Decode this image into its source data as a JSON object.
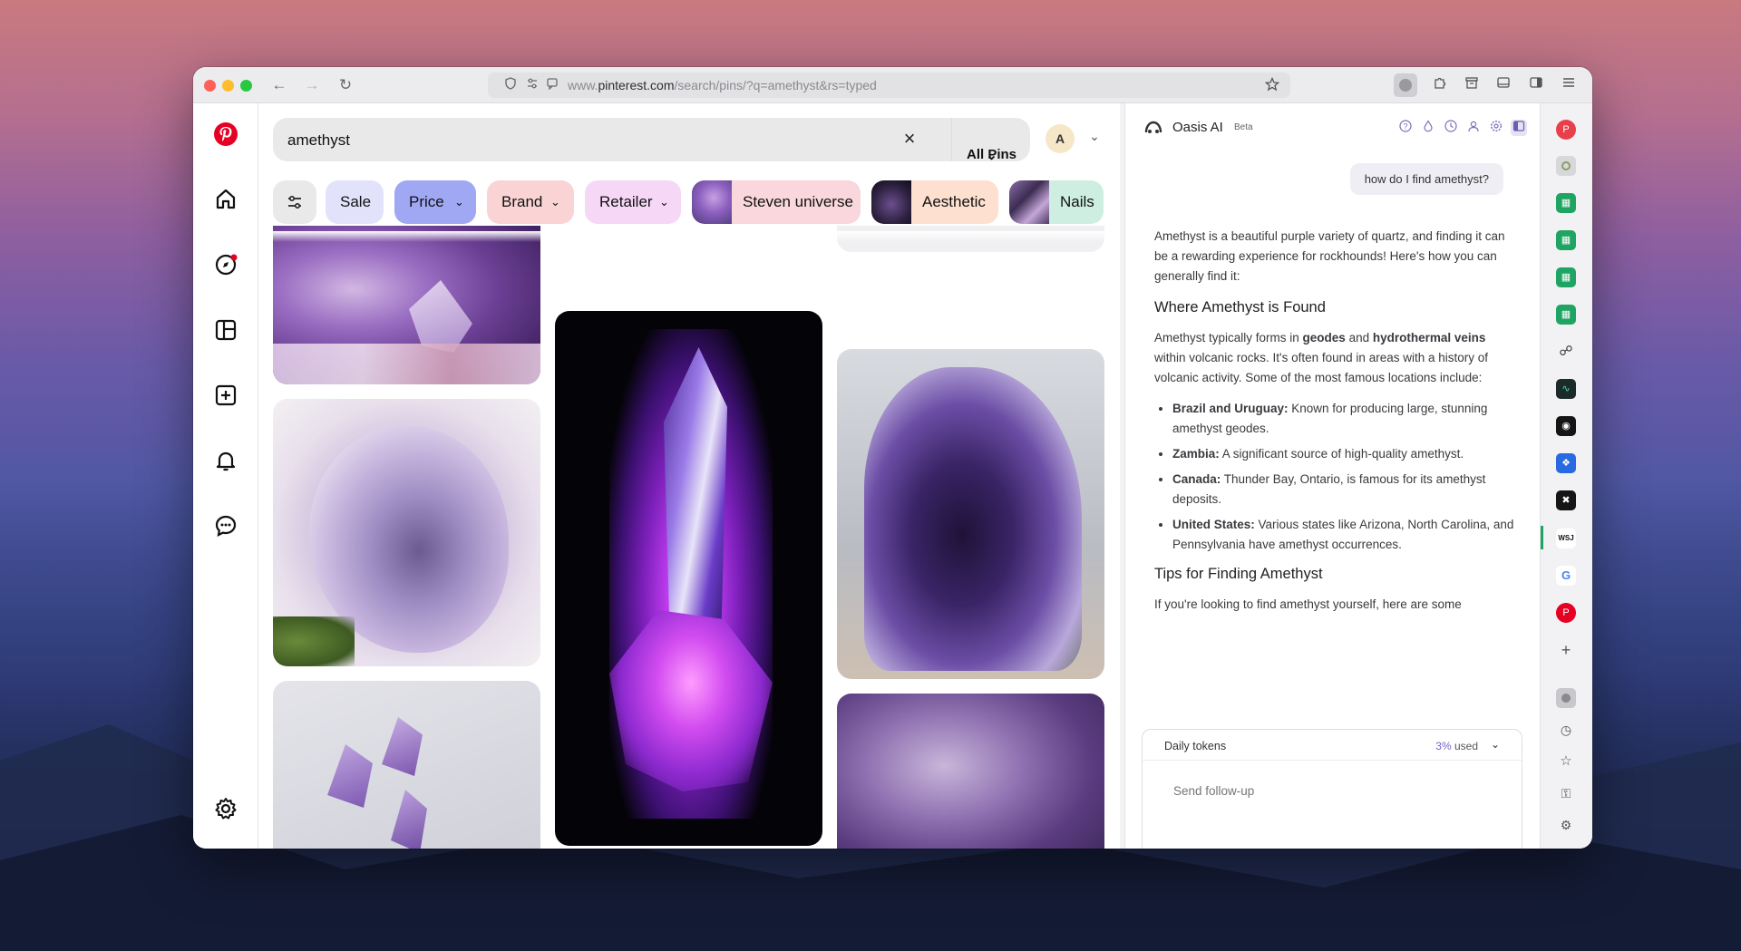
{
  "browser": {
    "url_prefix": "www.",
    "url_domain": "pinterest.com",
    "url_path": "/search/pins/?q=amethyst&rs=typed"
  },
  "search": {
    "query": "amethyst",
    "scope_label": "All Pins",
    "avatar_initial": "A"
  },
  "chips": [
    "Sale",
    "Price",
    "Brand",
    "Retailer",
    "Steven universe",
    "Aesthetic",
    "Nails"
  ],
  "colors": {
    "pinterest_red": "#e60023",
    "price_chip": "#a0a8f4",
    "brand_chip": "#fad4d4",
    "retailer_chip": "#f6d8f6",
    "accent_purple": "#6a4fa8"
  },
  "assistant": {
    "name": "Oasis AI",
    "badge": "Beta",
    "user_message": "how do I find amethyst?",
    "intro": "Amethyst is a beautiful purple variety of quartz, and finding it can be a rewarding experience for rockhounds! Here's how you can generally find it:",
    "h1": "Where Amethyst is Found",
    "p1_a": "Amethyst typically forms in ",
    "p1_b": "geodes",
    "p1_c": " and ",
    "p1_d": "hydrothermal veins",
    "p1_e": " within volcanic rocks. It's often found in areas with a history of volcanic activity. Some of the most famous locations include:",
    "locations": [
      {
        "name": "Brazil and Uruguay:",
        "text": " Known for producing large, stunning amethyst geodes."
      },
      {
        "name": "Zambia:",
        "text": " A significant source of high-quality amethyst."
      },
      {
        "name": "Canada:",
        "text": " Thunder Bay, Ontario, is famous for its amethyst deposits."
      },
      {
        "name": "United States:",
        "text": " Various states like Arizona, North Carolina, and Pennsylvania have amethyst occurrences."
      }
    ],
    "h2": "Tips for Finding Amethyst",
    "p2": "If you're looking to find amethyst yourself, here are some",
    "tokens_label": "Daily tokens",
    "tokens_pct": "3%",
    "tokens_suffix": " used",
    "followup_placeholder": "Send follow-up"
  },
  "strip_icons": [
    "pinterest-app",
    "app",
    "sheets",
    "sheets",
    "sheets",
    "sheets",
    "globe",
    "chart-app",
    "app",
    "app",
    "app",
    "wsj",
    "google",
    "pinterest"
  ],
  "strip_labels": {
    "wsj": "WSJ",
    "google": "G"
  }
}
